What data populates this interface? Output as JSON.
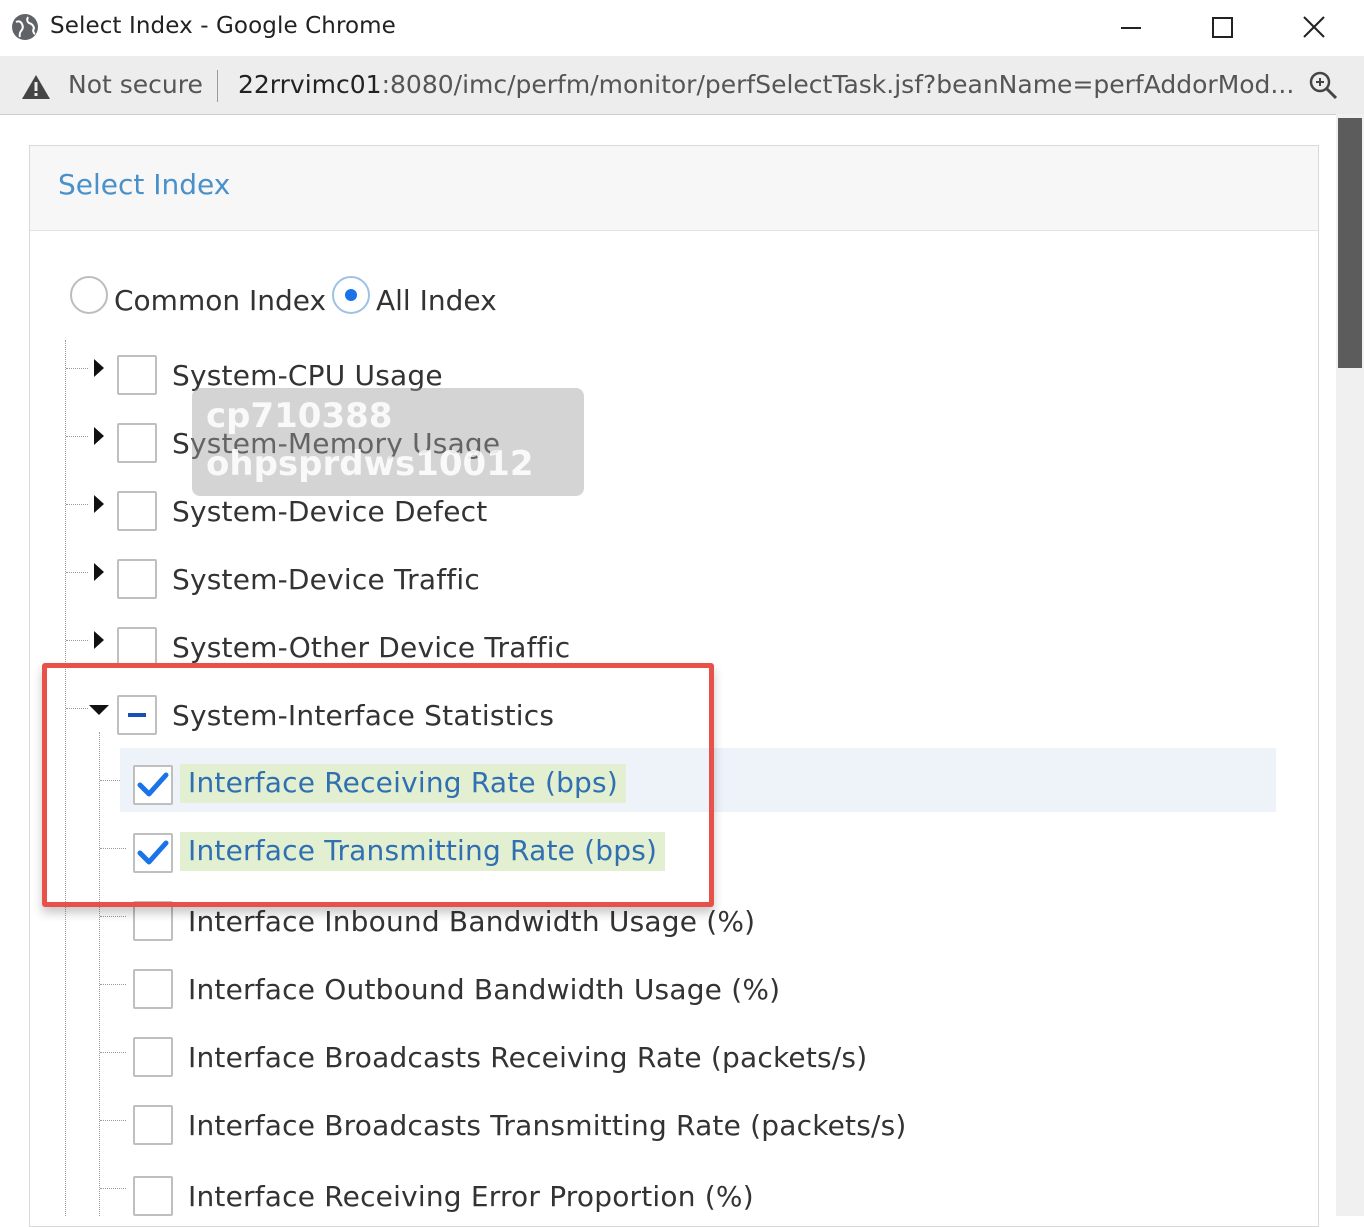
{
  "window": {
    "title": "Select Index - Google Chrome",
    "controls": {
      "minimize": "minimize",
      "maximize": "maximize",
      "close": "close"
    }
  },
  "address_bar": {
    "security_label": "Not secure",
    "url_host": "22rrvimc01",
    "url_rest": ":8080/imc/perfm/monitor/perfSelectTask.jsf?beanName=perfAddorMod..."
  },
  "panel": {
    "title": "Select Index",
    "radios": [
      {
        "label": "Common Index",
        "checked": false
      },
      {
        "label": "All Index",
        "checked": true
      }
    ],
    "tree": [
      {
        "label": "System-CPU Usage",
        "expanded": false,
        "state": "unchecked"
      },
      {
        "label": "System-Memory Usage",
        "expanded": false,
        "state": "unchecked"
      },
      {
        "label": "System-Device Defect",
        "expanded": false,
        "state": "unchecked"
      },
      {
        "label": "System-Device Traffic",
        "expanded": false,
        "state": "unchecked"
      },
      {
        "label": "System-Other Device Traffic",
        "expanded": false,
        "state": "unchecked"
      },
      {
        "label": "System-Interface Statistics",
        "expanded": true,
        "state": "partial",
        "children": [
          {
            "label": "Interface Receiving Rate (bps)",
            "checked": true
          },
          {
            "label": "Interface Transmitting Rate (bps)",
            "checked": true
          },
          {
            "label": "Interface Inbound Bandwidth Usage (%)",
            "checked": false
          },
          {
            "label": "Interface Outbound Bandwidth Usage (%)",
            "checked": false
          },
          {
            "label": "Interface Broadcasts Receiving Rate (packets/s)",
            "checked": false
          },
          {
            "label": "Interface Broadcasts Transmitting Rate (packets/s)",
            "checked": false
          },
          {
            "label": "Interface Receiving Error Proportion (%)",
            "checked": false
          }
        ]
      }
    ]
  },
  "watermark": {
    "line1": "cp710388",
    "line2": "ohpsprdws10012"
  },
  "colors": {
    "accent": "#1a73e8",
    "title_blue": "#4a90c9",
    "highlight_green": "#e2efd0",
    "callout_red": "#e8504a"
  }
}
